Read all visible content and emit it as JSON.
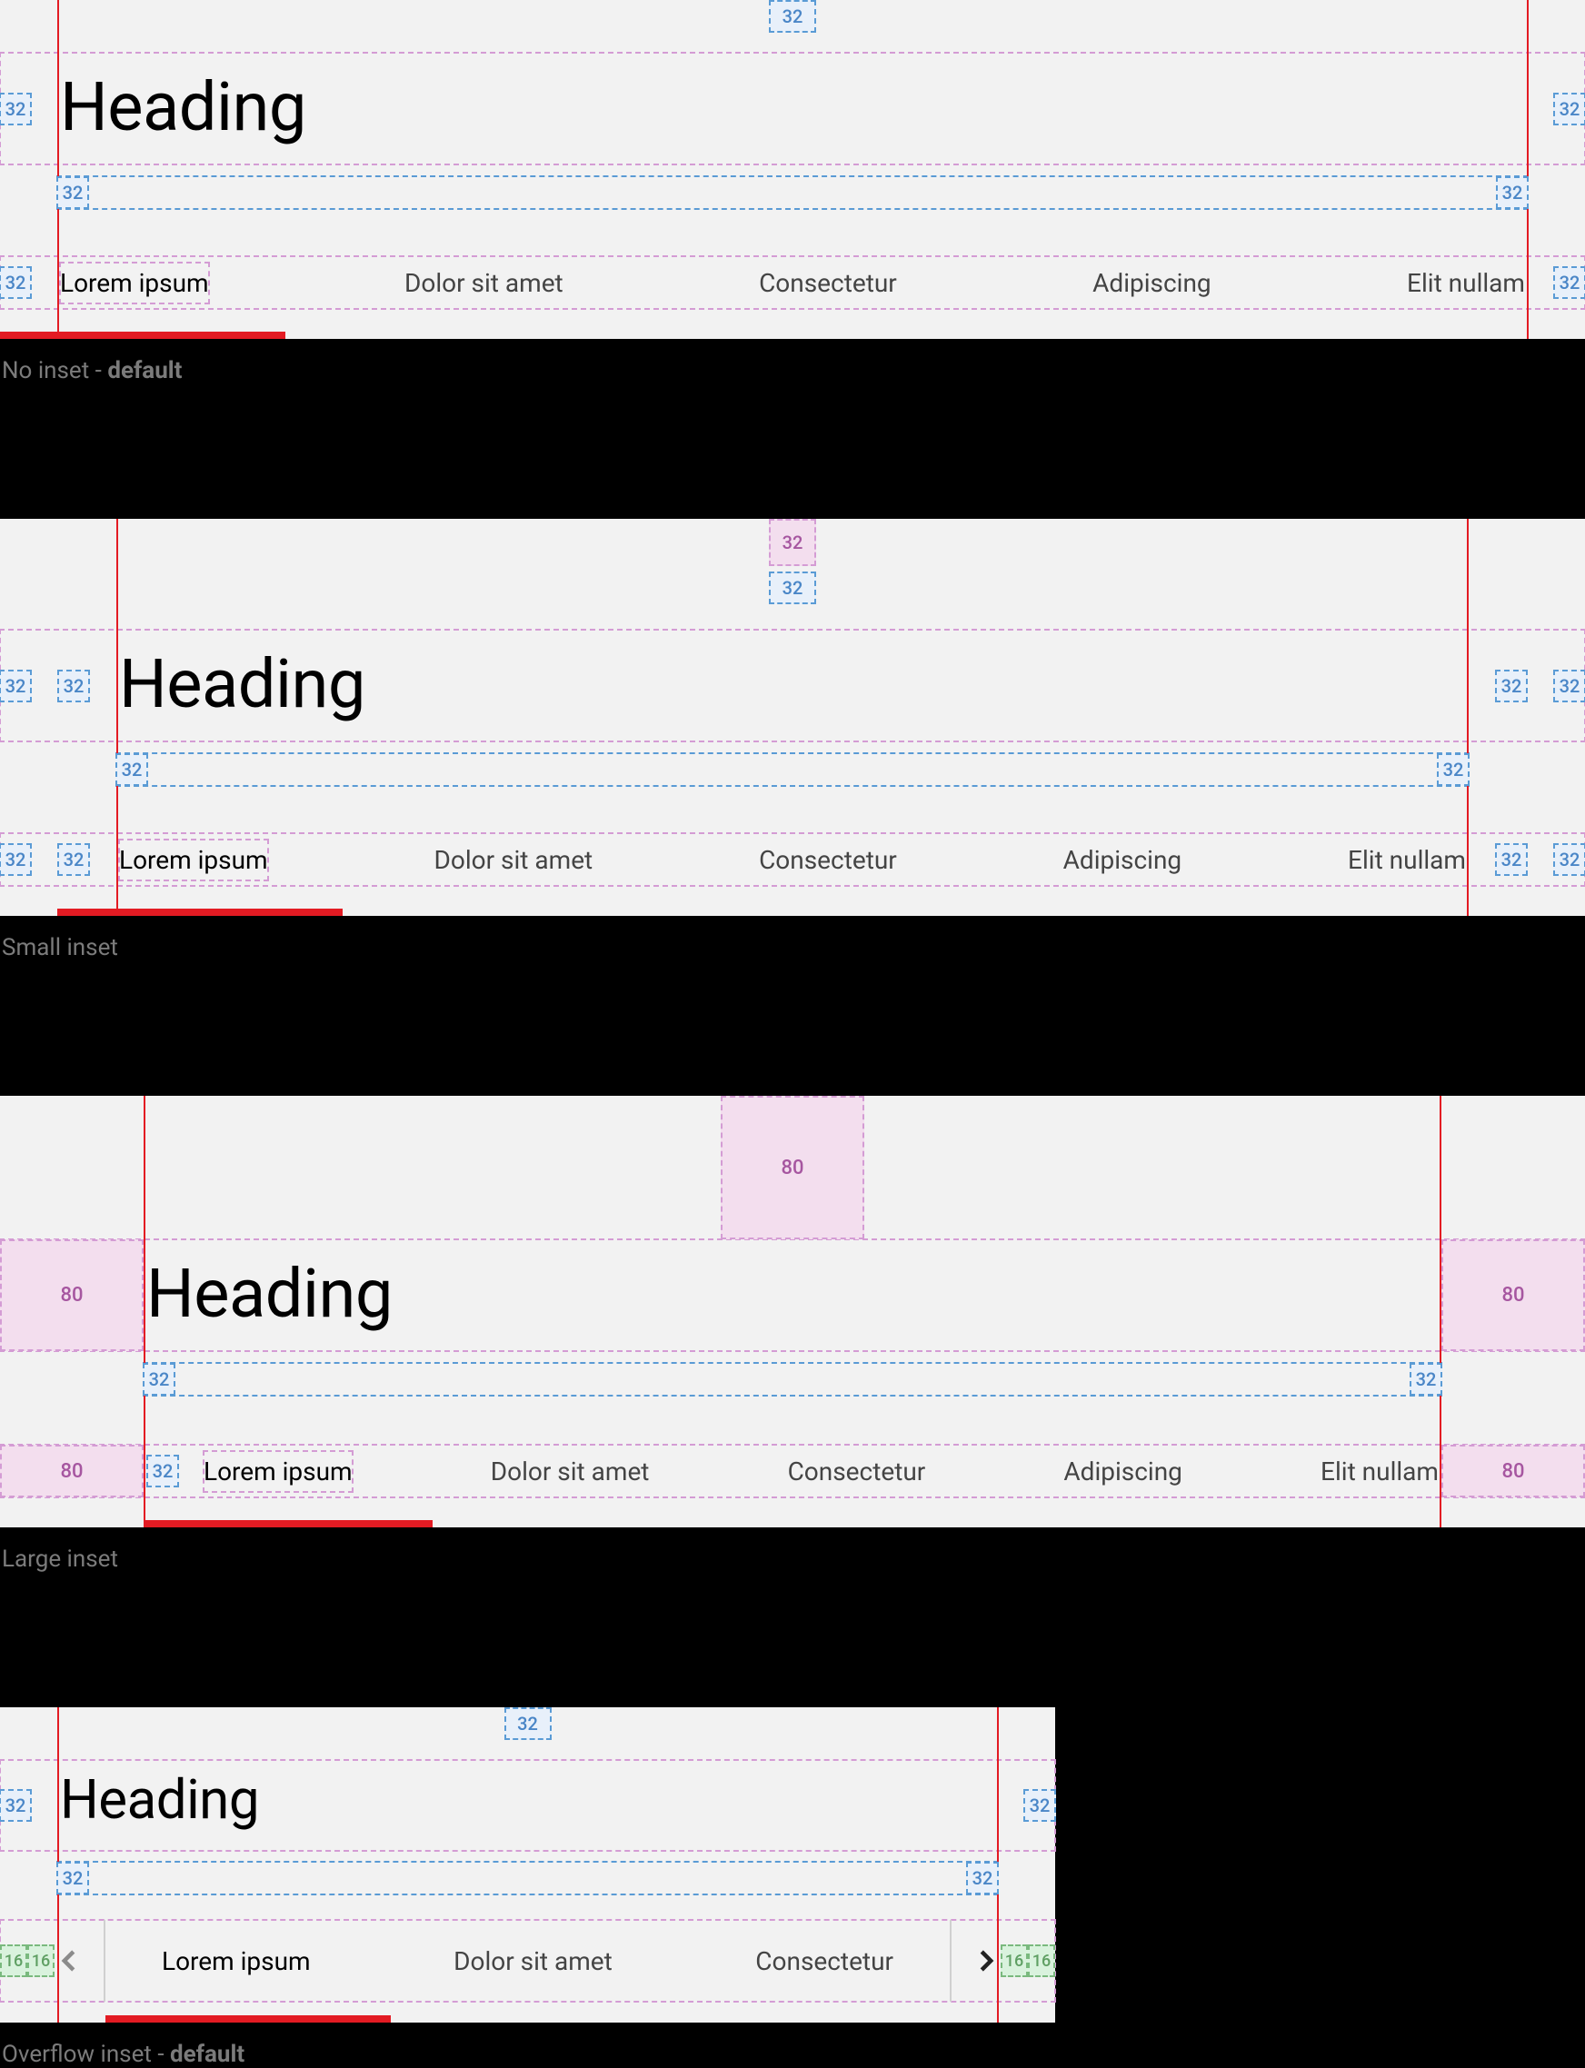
{
  "spacing": {
    "s16": "16",
    "s32": "32",
    "s80": "80"
  },
  "heading": "Heading",
  "tabs": {
    "t0": "Lorem ipsum",
    "t1": "Dolor sit amet",
    "t2": "Consectetur",
    "t3": "Adipiscing",
    "t4": "Elit nullam"
  },
  "captions": {
    "noInset_a": "No inset - ",
    "noInset_b": "default",
    "small": "Small inset",
    "large": "Large inset",
    "overflow_a": "Overflow inset - ",
    "overflow_b": "default"
  }
}
